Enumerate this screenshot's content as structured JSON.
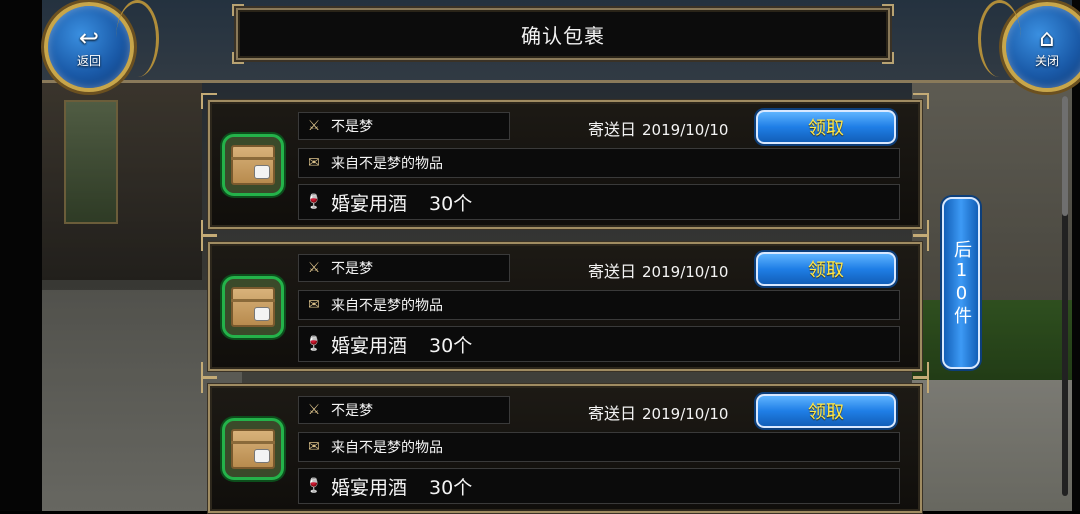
{
  "header": {
    "title": "确认包裹",
    "back_label": "返回",
    "close_label": "关闭"
  },
  "mails": [
    {
      "sender": "不是梦",
      "date_label": "寄送日",
      "date": "2019/10/10",
      "claim_label": "领取",
      "description": "来自不是梦的物品",
      "item_name": "婚宴用酒",
      "item_qty": "30个"
    },
    {
      "sender": "不是梦",
      "date_label": "寄送日",
      "date": "2019/10/10",
      "claim_label": "领取",
      "description": "来自不是梦的物品",
      "item_name": "婚宴用酒",
      "item_qty": "30个"
    },
    {
      "sender": "不是梦",
      "date_label": "寄送日",
      "date": "2019/10/10",
      "claim_label": "领取",
      "description": "来自不是梦的物品",
      "item_name": "婚宴用酒",
      "item_qty": "30个"
    }
  ],
  "pagination": {
    "next_label": "后10件"
  },
  "colors": {
    "claim_text": "#ffe84a",
    "button_blue": "#1f7ee6",
    "frame_gold": "#a08c62",
    "icon_border_green": "#24b24a"
  }
}
